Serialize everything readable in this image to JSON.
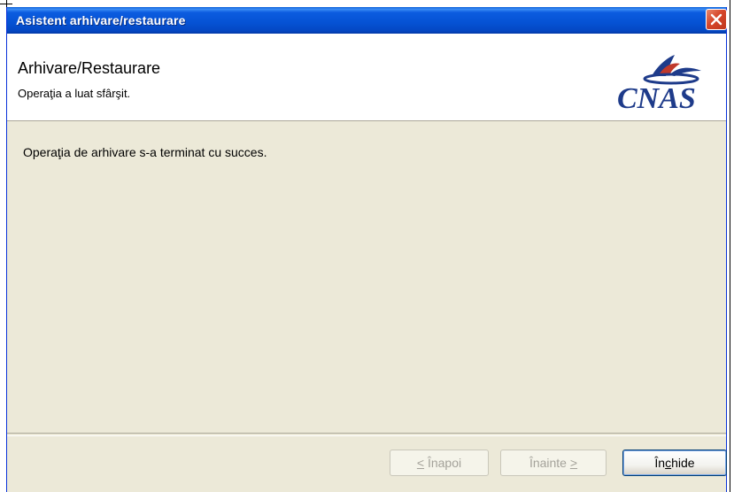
{
  "window": {
    "title": "Asistent arhivare/restaurare"
  },
  "header": {
    "title": "Arhivare/Restaurare",
    "subtitle": "Operaţia a luat sfârşit.",
    "logo_text": "CNAS"
  },
  "content": {
    "message": "Operaţia de arhivare s-a terminat cu succes."
  },
  "buttons": {
    "back": {
      "prefix": "< ",
      "label": "Înapoi",
      "accel": "<",
      "enabled": false
    },
    "next": {
      "label": "Înainte",
      "suffix": " >",
      "enabled": false
    },
    "close": {
      "before": "În",
      "accel": "c",
      "after": "hide",
      "enabled": true
    }
  },
  "colors": {
    "titlebar": "#0552d4",
    "dialog_bg": "#ece9d8",
    "logo": "#1e3b8a",
    "logo_accent": "#c0392b"
  },
  "icons": {
    "close": "close-icon",
    "logo": "cnas-logo"
  }
}
